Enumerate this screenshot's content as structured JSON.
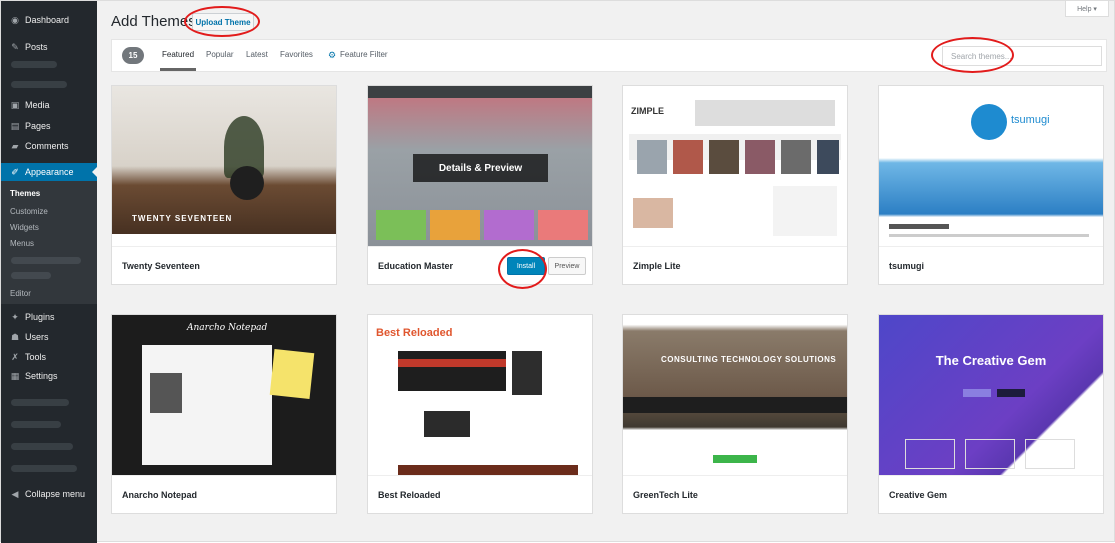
{
  "sidebar": {
    "items": {
      "dashboard": "Dashboard",
      "posts": "Posts",
      "media": "Media",
      "pages": "Pages",
      "comments": "Comments",
      "appearance": "Appearance",
      "plugins": "Plugins",
      "users": "Users",
      "tools": "Tools",
      "settings": "Settings",
      "collapse": "Collapse menu"
    },
    "submenu": {
      "themes": "Themes",
      "customize": "Customize",
      "widgets": "Widgets",
      "menus": "Menus",
      "editor": "Editor"
    }
  },
  "header": {
    "title": "Add Themes",
    "upload_label": "Upload Theme",
    "help_label": "Help ▾"
  },
  "filter_bar": {
    "count": "15",
    "tabs": {
      "featured": "Featured",
      "popular": "Popular",
      "latest": "Latest",
      "favorites": "Favorites",
      "feature_filter": "Feature Filter"
    },
    "search_placeholder": "Search themes..."
  },
  "themes": {
    "twenty_seventeen": {
      "name": "Twenty Seventeen",
      "banner": "TWENTY SEVENTEEN"
    },
    "education_master": {
      "name": "Education Master",
      "overlay": "Details & Preview",
      "install": "Install",
      "preview": "Preview"
    },
    "zimple_lite": {
      "name": "Zimple Lite",
      "logo": "ZIMPLE"
    },
    "tsumugi": {
      "name": "tsumugi",
      "logo": "tsumugi"
    },
    "anarcho_notepad": {
      "name": "Anarcho Notepad",
      "banner": "Anarcho Notepad"
    },
    "best_reloaded": {
      "name": "Best Reloaded",
      "banner": "Best Reloaded"
    },
    "greentech_lite": {
      "name": "GreenTech Lite",
      "banner": "CONSULTING TECHNOLOGY SOLUTIONS"
    },
    "creative_gem": {
      "name": "Creative Gem",
      "banner": "The Creative Gem"
    }
  },
  "colors": {
    "sidebar": "#23282d",
    "active": "#0073aa",
    "annotation": "#e21b1b"
  }
}
